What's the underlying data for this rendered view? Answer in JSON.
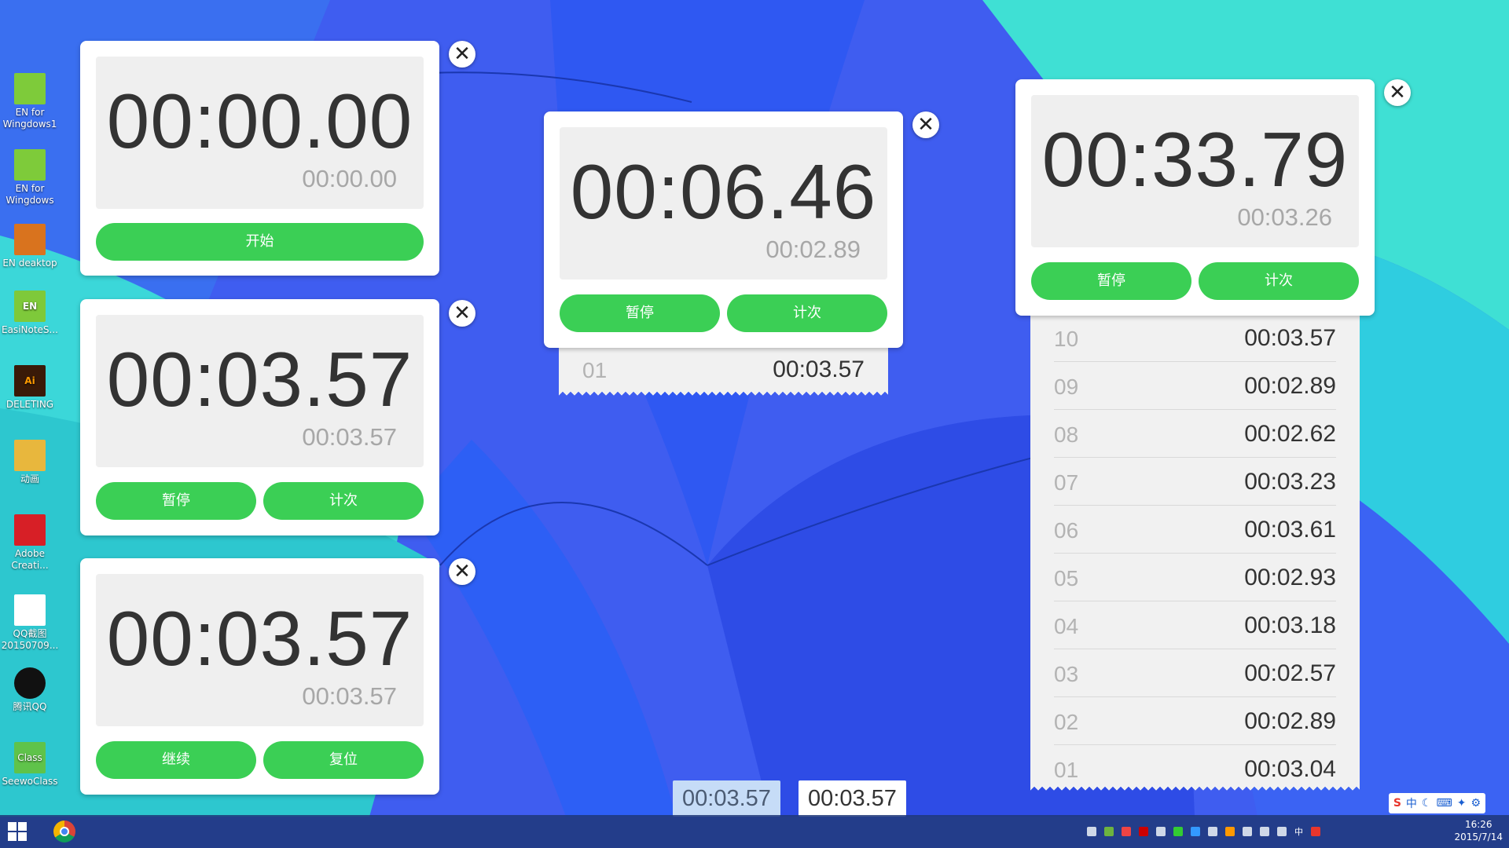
{
  "desktop": {
    "icons": [
      {
        "label": "EN for Wingdows1"
      },
      {
        "label": "EN for Wingdows"
      },
      {
        "label": "EN deaktop"
      },
      {
        "label": "EasiNoteS..."
      },
      {
        "label": "DELETING"
      },
      {
        "label": "动画"
      },
      {
        "label": "Adobe Creati..."
      },
      {
        "label": "QQ截图 20150709..."
      },
      {
        "label": "腾讯QQ"
      },
      {
        "label": "SeewoClass"
      }
    ]
  },
  "icons": {
    "close": "✕"
  },
  "sw1": {
    "main": "00:00.00",
    "sub": "00:00.00",
    "btn1": "开始"
  },
  "sw2": {
    "main": "00:03.57",
    "sub": "00:03.57",
    "btn1": "暂停",
    "btn2": "计次"
  },
  "sw3": {
    "main": "00:03.57",
    "sub": "00:03.57",
    "btn1": "继续",
    "btn2": "复位"
  },
  "sw4": {
    "main": "00:06.46",
    "sub": "00:02.89",
    "btn1": "暂停",
    "btn2": "计次",
    "laps": [
      {
        "n": "01",
        "t": "00:03.57"
      }
    ]
  },
  "sw5": {
    "main": "00:33.79",
    "sub": "00:03.26",
    "btn1": "暂停",
    "btn2": "计次",
    "laps": [
      {
        "n": "10",
        "t": "00:03.57"
      },
      {
        "n": "09",
        "t": "00:02.89"
      },
      {
        "n": "08",
        "t": "00:02.62"
      },
      {
        "n": "07",
        "t": "00:03.23"
      },
      {
        "n": "06",
        "t": "00:03.61"
      },
      {
        "n": "05",
        "t": "00:02.93"
      },
      {
        "n": "04",
        "t": "00:03.18"
      },
      {
        "n": "03",
        "t": "00:02.57"
      },
      {
        "n": "02",
        "t": "00:02.89"
      },
      {
        "n": "01",
        "t": "00:03.04"
      }
    ]
  },
  "chips": [
    "00:03.57",
    "00:03.57"
  ],
  "ime": {
    "mode": "中"
  },
  "taskbar": {
    "time": "16:26",
    "date": "2015/7/14"
  },
  "colors": {
    "accent_green": "#3bcf55",
    "display_bg": "#efefef",
    "lap_bg": "#f1f1f1"
  }
}
